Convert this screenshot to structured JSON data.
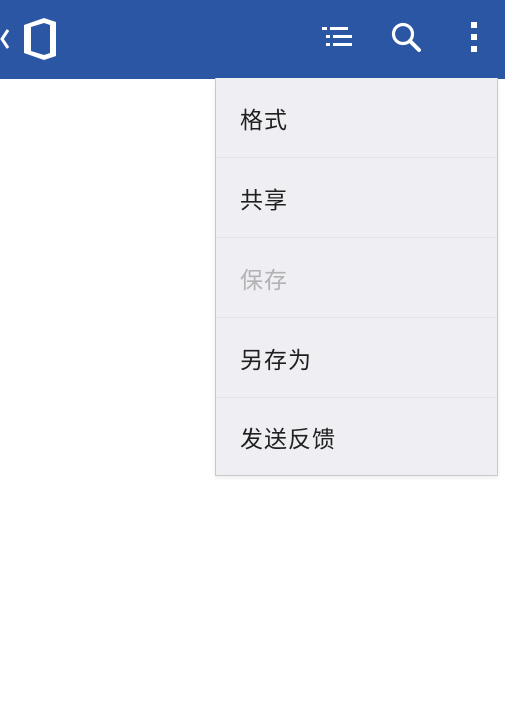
{
  "appbar": {
    "background_color": "#2b56a4",
    "icons": {
      "back": "chevron-left-icon",
      "logo": "office-logo-icon",
      "outline": "outline-list-icon",
      "search": "search-icon",
      "more": "more-vertical-icon"
    }
  },
  "menu": {
    "items": [
      {
        "label": "格式",
        "enabled": true
      },
      {
        "label": "共享",
        "enabled": true
      },
      {
        "label": "保存",
        "enabled": false
      },
      {
        "label": "另存为",
        "enabled": true
      },
      {
        "label": "发送反馈",
        "enabled": true
      }
    ]
  }
}
